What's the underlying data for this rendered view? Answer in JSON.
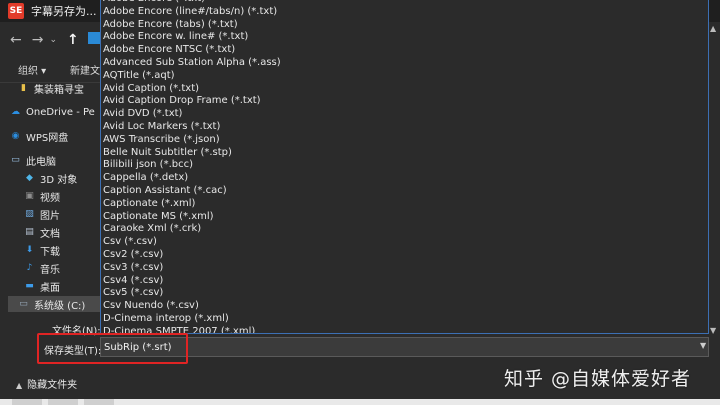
{
  "window": {
    "title": "字幕另存为...",
    "app_icon_text": "SE",
    "app_icon_color": "#e23b2a"
  },
  "nav": {
    "back": "←",
    "forward": "→",
    "dropdown": "⌄",
    "up": "↑"
  },
  "toolbar": {
    "organize": "组织 ▾",
    "new_folder": "新建文"
  },
  "sidebar": {
    "items": [
      {
        "label": "集装箱寻宝",
        "icon": "folder-icon",
        "glyph": "▮",
        "color": "#e8c04a"
      },
      {
        "label": "OneDrive - Pe",
        "icon": "cloud-icon",
        "glyph": "☁",
        "color": "#2b8ee0"
      },
      {
        "label": "WPS网盘",
        "icon": "cloud-drive-icon",
        "glyph": "◉",
        "color": "#2b8ee0"
      },
      {
        "label": "此电脑",
        "icon": "computer-icon",
        "glyph": "▭",
        "color": "#9ec6ea"
      },
      {
        "label": "3D 对象",
        "icon": "cube-icon",
        "glyph": "◆",
        "color": "#4fb5e8"
      },
      {
        "label": "视频",
        "icon": "video-icon",
        "glyph": "▣",
        "color": "#8e8e8e"
      },
      {
        "label": "图片",
        "icon": "picture-icon",
        "glyph": "▨",
        "color": "#6fa8dc"
      },
      {
        "label": "文档",
        "icon": "document-icon",
        "glyph": "▤",
        "color": "#b9c6d6"
      },
      {
        "label": "下载",
        "icon": "download-icon",
        "glyph": "⬇",
        "color": "#3d9be9"
      },
      {
        "label": "音乐",
        "icon": "music-icon",
        "glyph": "♪",
        "color": "#3d9be9"
      },
      {
        "label": "桌面",
        "icon": "desktop-icon",
        "glyph": "▬",
        "color": "#3d9be9"
      },
      {
        "label": "系统级 (C:)",
        "icon": "drive-icon",
        "glyph": "▭",
        "color": "#9ab"
      }
    ]
  },
  "format_list": [
    "Adobe Encore (*.txt)",
    "Adobe Encore (line#/tabs/n) (*.txt)",
    "Adobe Encore (tabs) (*.txt)",
    "Adobe Encore w. line# (*.txt)",
    "Adobe Encore NTSC (*.txt)",
    "Advanced Sub Station Alpha (*.ass)",
    "AQTitle (*.aqt)",
    "Avid Caption (*.txt)",
    "Avid Caption Drop Frame (*.txt)",
    "Avid DVD (*.txt)",
    "Avid Loc Markers (*.txt)",
    "AWS Transcribe (*.json)",
    "Belle Nuit Subtitler (*.stp)",
    "Bilibili json (*.bcc)",
    "Cappella (*.detx)",
    "Caption Assistant (*.cac)",
    "Captionate (*.xml)",
    "Captionate MS (*.xml)",
    "Caraoke Xml (*.crk)",
    "Csv (*.csv)",
    "Csv2 (*.csv)",
    "Csv3 (*.csv)",
    "Csv4 (*.csv)",
    "Csv5 (*.csv)",
    "Csv Nuendo (*.csv)",
    "D-Cinema interop (*.xml)",
    "D-Cinema SMPTE 2007 (*.xml)"
  ],
  "fields": {
    "filename_label": "文件名(N):",
    "savetype_label": "保存类型(T):",
    "savetype_value": "SubRip (*.srt)"
  },
  "footer": {
    "hide_folders": "隐藏文件夹"
  },
  "watermark": "知乎 @自媒体爱好者",
  "colors": {
    "highlight": "#e02424",
    "dropdown_border": "#3c6fb3"
  }
}
